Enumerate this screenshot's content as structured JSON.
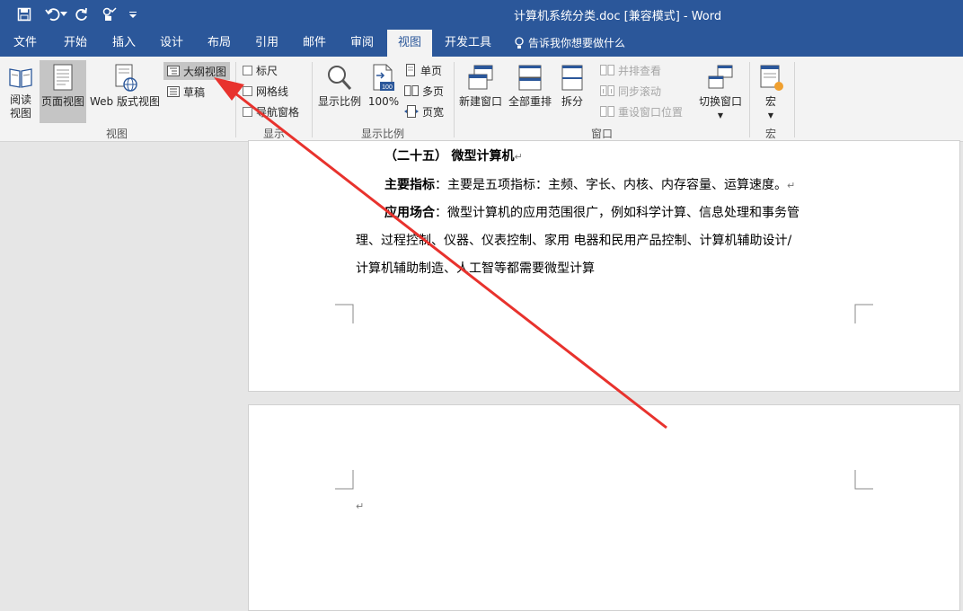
{
  "window": {
    "title": "计算机系统分类.doc [兼容模式] - Word"
  },
  "quick_access": {
    "save": "save",
    "undo": "undo",
    "redo": "repeat",
    "touch": "touch-mode",
    "customize": "customize"
  },
  "tabs": [
    "文件",
    "开始",
    "插入",
    "设计",
    "布局",
    "引用",
    "邮件",
    "审阅",
    "视图",
    "开发工具"
  ],
  "active_tab": "视图",
  "tell_me": "告诉我你想要做什么",
  "ribbon": {
    "views": {
      "group_label": "视图",
      "read_mode": "阅读\n视图",
      "read_mode_l1": "阅读",
      "read_mode_l2": "视图",
      "print_layout": "页面视图",
      "web_layout": "Web 版式视图",
      "outline": "大纲视图",
      "draft": "草稿"
    },
    "show": {
      "group_label": "显示",
      "ruler": "标尺",
      "gridlines": "网格线",
      "nav_pane": "导航窗格"
    },
    "zoom": {
      "group_label": "显示比例",
      "zoom": "显示比例",
      "hundred": "100%",
      "one_page": "单页",
      "multi_page": "多页",
      "page_width": "页宽"
    },
    "window": {
      "group_label": "窗口",
      "new_window": "新建窗口",
      "arrange_all": "全部重排",
      "split": "拆分",
      "side_by_side": "并排查看",
      "sync_scroll": "同步滚动",
      "reset_pos": "重设窗口位置",
      "switch": "切换窗口"
    },
    "macros": {
      "group_label": "宏",
      "macros": "宏"
    }
  },
  "document": {
    "heading_num": "（二十五）",
    "heading_title": "微型计算机",
    "p1_label": "主要指标",
    "p1_text": "：主要是五项指标：主频、字长、内核、内存容量、运算速度。",
    "p2_label": "应用场合",
    "p2_text": "：微型计算机的应用范围很广，例如科学计算、信息处理和事务管",
    "p2_line2": "理、过程控制、仪器、仪表控制、家用 电器和民用产品控制、计算机辅助设计/",
    "p2_line3": "计算机辅助制造、人工智等都需要微型计算",
    "para_mark": "↵"
  },
  "colors": {
    "brand": "#2b579a",
    "annotation_arrow": "#e8322d"
  }
}
